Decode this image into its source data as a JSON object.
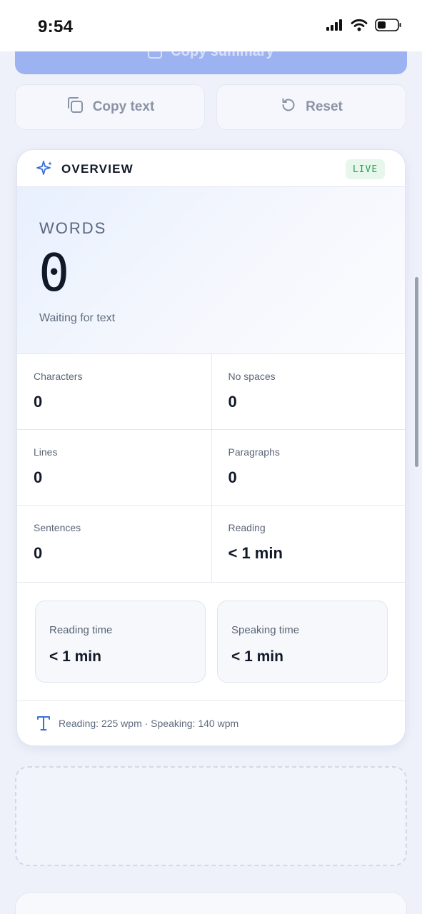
{
  "status_bar": {
    "time": "9:54"
  },
  "top_actions": {
    "copy_summary_label": "Copy summary",
    "copy_text_label": "Copy text",
    "reset_label": "Reset"
  },
  "overview": {
    "title": "OVERVIEW",
    "badge": "LIVE",
    "hero": {
      "label": "WORDS",
      "value": "0",
      "caption": "Waiting for text"
    },
    "stats": [
      {
        "label": "Characters",
        "value": "0"
      },
      {
        "label": "No spaces",
        "value": "0"
      },
      {
        "label": "Lines",
        "value": "0"
      },
      {
        "label": "Paragraphs",
        "value": "0"
      },
      {
        "label": "Sentences",
        "value": "0"
      },
      {
        "label": "Reading",
        "value": "< 1 min"
      }
    ],
    "times": [
      {
        "label": "Reading time",
        "value": "< 1 min"
      },
      {
        "label": "Speaking time",
        "value": "< 1 min"
      }
    ],
    "footer_note": "Reading: 225 wpm · Speaking: 140 wpm"
  },
  "colors": {
    "accent": "#3b6fd8",
    "primary_button": "#9db2f0",
    "live_badge_text": "#2ea05a",
    "live_badge_bg": "#e8f7ec"
  }
}
